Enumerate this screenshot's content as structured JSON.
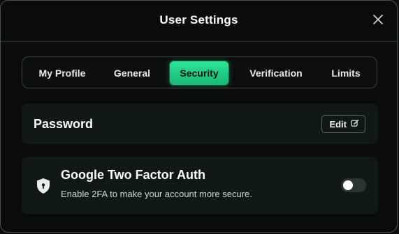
{
  "dialog": {
    "title": "User Settings"
  },
  "tabs": [
    {
      "label": "My Profile"
    },
    {
      "label": "General"
    },
    {
      "label": "Security",
      "active": true
    },
    {
      "label": "Verification"
    },
    {
      "label": "Limits"
    }
  ],
  "password": {
    "title": "Password",
    "edit_label": "Edit"
  },
  "twofa": {
    "title": "Google Two Factor Auth",
    "subtitle": "Enable 2FA to make your account more secure.",
    "enabled": false
  },
  "colors": {
    "accent": "#2ee59a",
    "background": "#0a0c0c",
    "card": "#101917"
  },
  "icons": [
    "close-icon",
    "edit-icon",
    "shield-icon"
  ]
}
